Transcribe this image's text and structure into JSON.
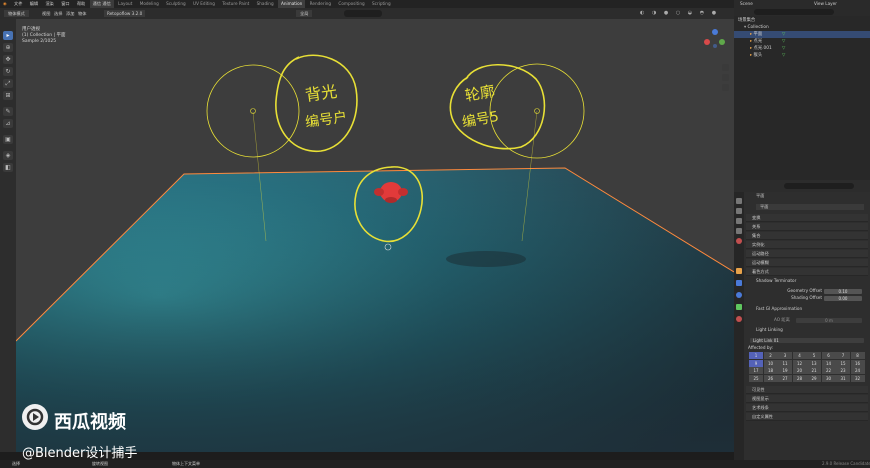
{
  "topbar": {
    "menus": [
      "文件",
      "编辑",
      "渲染",
      "窗口",
      "帮助"
    ],
    "active_menu": "通信 通信",
    "workspaces": [
      "Layout",
      "Modeling",
      "Sculpting",
      "UV Editing",
      "Texture Paint",
      "Shading",
      "Animation",
      "Rendering",
      "Compositing",
      "Scripting"
    ],
    "active_workspace": "Animation",
    "scene": "Scene",
    "view_layer": "View Layer"
  },
  "viewport_header": {
    "mode": "物体模式",
    "menus": [
      "视图",
      "选择",
      "添加",
      "物体"
    ],
    "addon": "Retopoflow 3.2.0",
    "transform": "全局",
    "center_menus": [
      "视图",
      "摄入",
      "平面"
    ]
  },
  "viewport": {
    "overlay_lines": [
      "用户透视",
      "(1) Collection | 平面",
      "Sample 2/1025"
    ],
    "annotation_left": "背光\n编号户",
    "annotation_right": "轮廓\n编号5"
  },
  "toolbar": {
    "tools": [
      "select-tool",
      "cursor-tool",
      "move-tool",
      "rotate-tool",
      "scale-tool",
      "transform-tool",
      "annotate-tool",
      "measure-tool",
      "add-cube-tool"
    ]
  },
  "outliner": {
    "title": "场景集合",
    "items": [
      {
        "label": "Collection",
        "indent": 1,
        "selected": false
      },
      {
        "label": "平面",
        "indent": 2,
        "selected": true
      },
      {
        "label": "点光",
        "indent": 2,
        "selected": false
      },
      {
        "label": "点光.001",
        "indent": 2,
        "selected": false
      },
      {
        "label": "猴头",
        "indent": 2,
        "selected": false
      }
    ]
  },
  "properties": {
    "object_name": "平面",
    "data_name": "平面",
    "sections": [
      "变换",
      "关系",
      "集合",
      "实例化",
      "运动路径",
      "运动模糊",
      "着色方式"
    ],
    "shadow_terminator": {
      "title": "Shadow Terminator",
      "geometry_offset_label": "Geometry Offset",
      "geometry_offset_value": "0.10",
      "shading_offset_label": "Shading Offset",
      "shading_offset_value": "0.00"
    },
    "fast_gi": {
      "title": "Fast GI Approximation",
      "label": "AO 距离",
      "value": "0 m"
    },
    "light_linking": {
      "title": "Light Linking",
      "field": "Light Link 01",
      "affected_by": "Affected by:",
      "grid": [
        "1",
        "2",
        "3",
        "4",
        "5",
        "6",
        "7",
        "8",
        "9",
        "10",
        "11",
        "12",
        "13",
        "14",
        "15",
        "16",
        "17",
        "18",
        "19",
        "20",
        "21",
        "22",
        "23",
        "24",
        "25",
        "26",
        "27",
        "28",
        "29",
        "30",
        "31",
        "32"
      ],
      "grid_on": [
        "1",
        "9"
      ]
    },
    "bottom_sections": [
      "可见性",
      "视图显示",
      "艺术线条",
      "自定义属性"
    ]
  },
  "status": {
    "left": "选择",
    "mid1": "旋转视图",
    "mid2": "物体上下文菜单",
    "version": "2.9.0 Release Candidate"
  },
  "watermark": {
    "brand": "西瓜视频",
    "handle": "@Blender设计捕手"
  },
  "colors": {
    "accent": "#4772b3",
    "ground": "#37a3b0",
    "plane_edge": "#ff8a3d",
    "annotation": "#e8e036",
    "monkey": "#e23a3a"
  }
}
